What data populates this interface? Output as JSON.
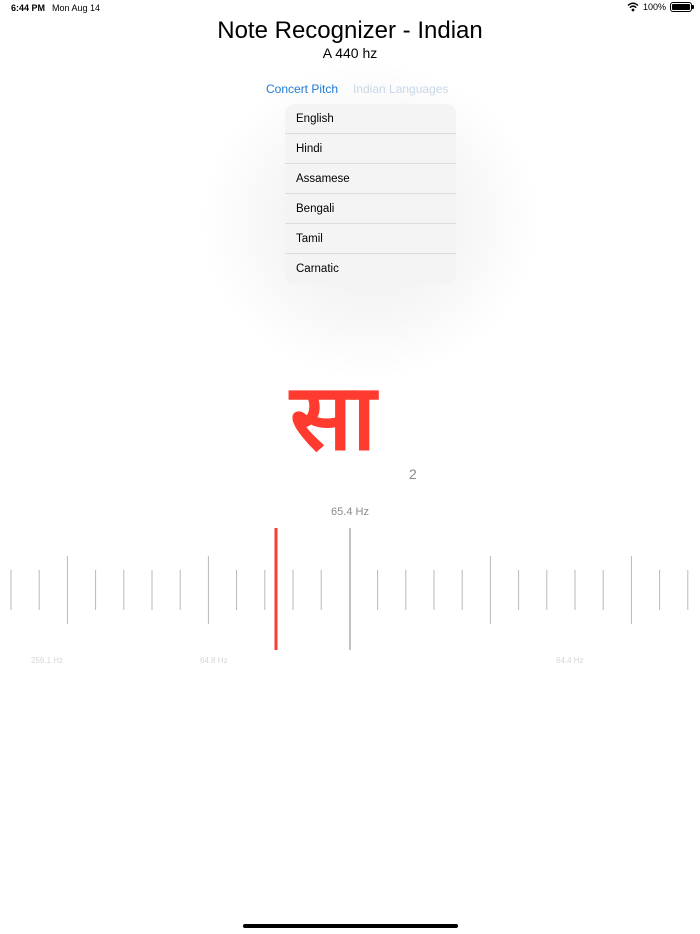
{
  "status": {
    "time": "6:44 PM",
    "date": "Mon Aug 14",
    "battery": "100%"
  },
  "app": {
    "title": "Note Recognizer - Indian",
    "subtitle": "A 440 hz"
  },
  "segments": {
    "concert": "Concert Pitch",
    "indian": "Indian Languages"
  },
  "menu": {
    "items": [
      "English",
      "Hindi",
      "Assamese",
      "Bengali",
      "Tamil",
      "Carnatic"
    ]
  },
  "reading": {
    "note": "सा",
    "octave": "2",
    "frequency": "65.4 Hz"
  },
  "scale_labels": {
    "left": "256.1 Hz",
    "mid": "64.8 Hz",
    "right": "64.4 Hz"
  },
  "colors": {
    "accent": "#ff3b30",
    "link": "#1d7bd6"
  }
}
